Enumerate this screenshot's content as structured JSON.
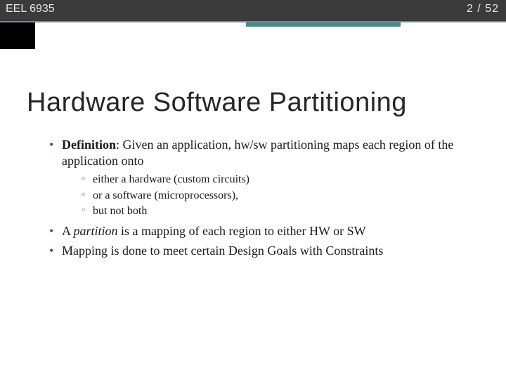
{
  "header": {
    "course_code": "EEL 6935",
    "page_current": "2",
    "page_sep": " / ",
    "page_total": "52"
  },
  "title": "Hardware Software Partitioning",
  "bullets": {
    "b1_label": "Definition",
    "b1_rest": ": Given an application, hw/sw partitioning maps each region of the application onto",
    "b1_sub1": "either a hardware (custom circuits)",
    "b1_sub2": "or a software (microprocessors),",
    "b1_sub3": "but not both",
    "b2_pre": "A ",
    "b2_em": "partition",
    "b2_post": " is a mapping of each region to either HW or SW",
    "b3": "Mapping is done to meet certain Design Goals with Constraints"
  }
}
